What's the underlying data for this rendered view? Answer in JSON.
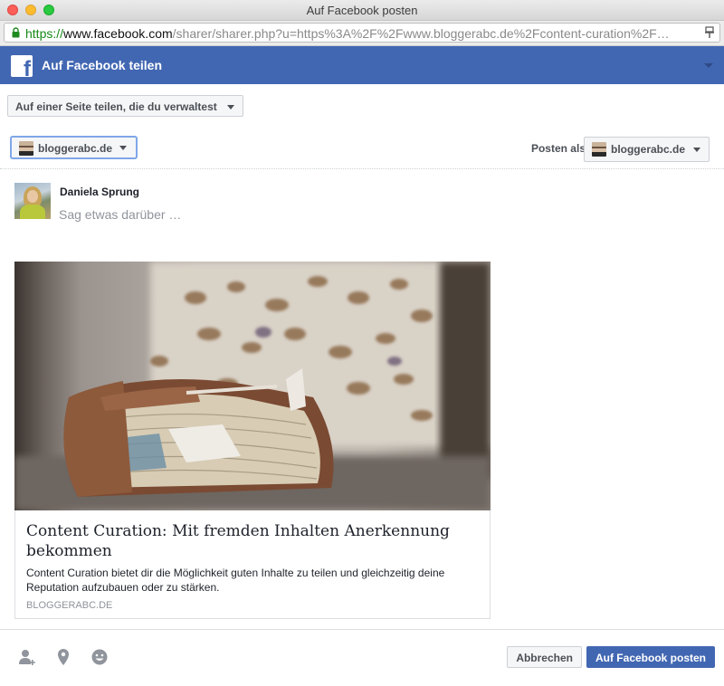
{
  "window": {
    "title": "Auf Facebook posten"
  },
  "browser": {
    "url_protocol": "https://",
    "url_host": "www.facebook.com",
    "url_rest": "/sharer/sharer.php?u=https%3A%2F%2Fwww.bloggerabc.de%2Fcontent-curation%2F…"
  },
  "header": {
    "title": "Auf Facebook teilen"
  },
  "share_target": {
    "label": "Auf einer Seite teilen, die du verwaltest"
  },
  "page_selector": {
    "selected": "bloggerabc.de"
  },
  "posting_as": {
    "label": "Posten als",
    "selected": "bloggerabc.de"
  },
  "composer": {
    "user_name": "Daniela Sprung",
    "placeholder": "Sag etwas darüber …"
  },
  "preview": {
    "title": "Content Curation: Mit fremden Inhalten Anerkennung bekommen",
    "description": "Content Curation bietet dir die Möglichkeit guten Inhalte zu teilen und gleichzeitig deine Reputation aufzubauen oder zu stärken.",
    "domain": "BLOGGERABC.DE"
  },
  "footer": {
    "icons": [
      "tag-friends-icon",
      "location-icon",
      "emoji-icon"
    ],
    "cancel_label": "Abbrechen",
    "post_label": "Auf Facebook posten"
  },
  "colors": {
    "facebook_blue": "#4267b2",
    "select_focus": "#7fa6e8",
    "secure_green": "#168a16"
  }
}
